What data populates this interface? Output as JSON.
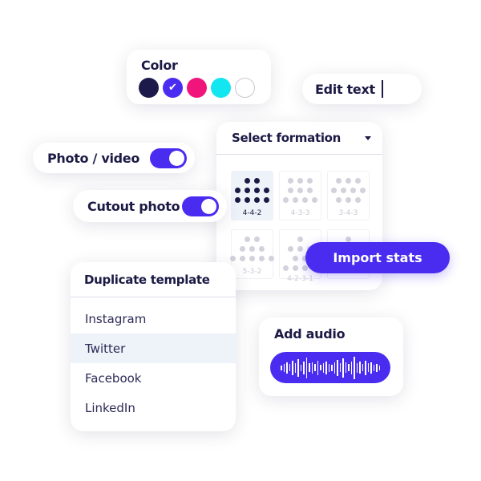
{
  "color": {
    "title": "Color",
    "swatches": [
      "#1c1a4a",
      "#4a2cf0",
      "#f0157a",
      "#12e6f0",
      "#ffffff"
    ],
    "selected": 1
  },
  "edit_text": {
    "label": "Edit text"
  },
  "formation": {
    "title": "Select formation",
    "options": [
      {
        "label": "4-4-2",
        "rows": [
          2,
          4,
          4
        ],
        "selected": true
      },
      {
        "label": "4-3-3",
        "rows": [
          3,
          3,
          4
        ]
      },
      {
        "label": "3-4-3",
        "rows": [
          3,
          4,
          3
        ]
      },
      {
        "label": "5-3-2",
        "rows": [
          2,
          3,
          5
        ]
      },
      {
        "label": "4-2-3-1",
        "rows": [
          1,
          3,
          2,
          4
        ]
      },
      {
        "label": "",
        "rows": [
          1,
          3
        ]
      }
    ]
  },
  "photo_video": {
    "label": "Photo / video",
    "on": true
  },
  "cutout_photo": {
    "label": "Cutout photo",
    "on": true
  },
  "import_stats": {
    "label": "Import stats"
  },
  "duplicate": {
    "title": "Duplicate template",
    "items": [
      "Instagram",
      "Twitter",
      "Facebook",
      "LinkedIn"
    ],
    "highlighted": 1
  },
  "audio": {
    "title": "Add audio"
  }
}
